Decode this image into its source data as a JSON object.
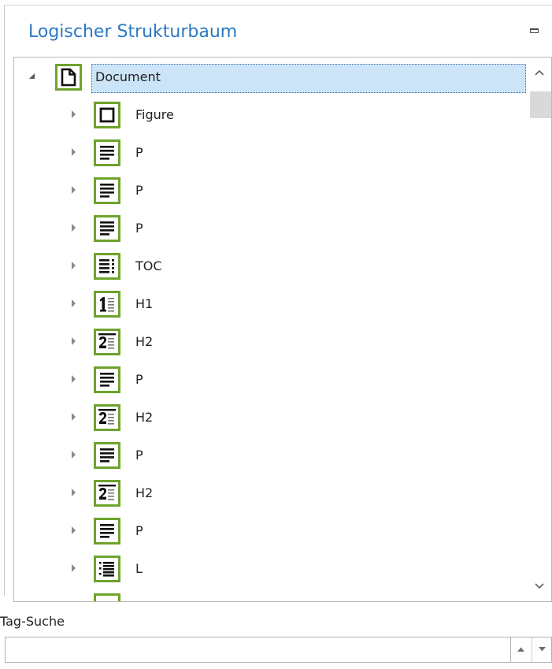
{
  "panel": {
    "title": "Logischer Strukturbaum"
  },
  "tree": {
    "root": {
      "label": "Document",
      "icon": "document-icon",
      "expanded": true,
      "selected": true
    },
    "children": [
      {
        "label": "Figure",
        "icon": "figure-icon"
      },
      {
        "label": "P",
        "icon": "paragraph-icon"
      },
      {
        "label": "P",
        "icon": "paragraph-icon"
      },
      {
        "label": "P",
        "icon": "paragraph-icon"
      },
      {
        "label": "TOC",
        "icon": "toc-icon"
      },
      {
        "label": "H1",
        "icon": "heading-1-icon"
      },
      {
        "label": "H2",
        "icon": "heading-2-icon"
      },
      {
        "label": "P",
        "icon": "paragraph-icon"
      },
      {
        "label": "H2",
        "icon": "heading-2-icon"
      },
      {
        "label": "P",
        "icon": "paragraph-icon"
      },
      {
        "label": "H2",
        "icon": "heading-2-icon"
      },
      {
        "label": "P",
        "icon": "paragraph-icon"
      },
      {
        "label": "L",
        "icon": "list-icon"
      }
    ]
  },
  "search": {
    "label": "Tag-Suche",
    "value": "",
    "placeholder": ""
  },
  "colors": {
    "title": "#2b79c2",
    "icon_border": "#6ea32c",
    "selection_bg": "#cce4f7"
  }
}
